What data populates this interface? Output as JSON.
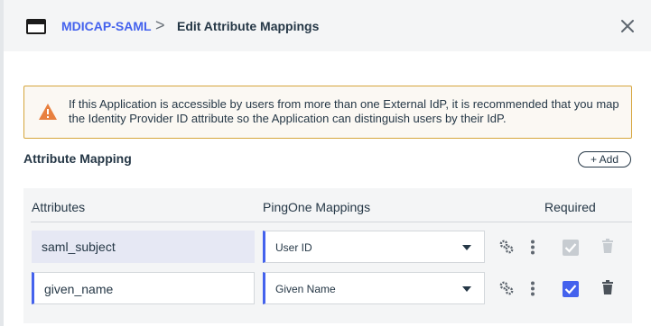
{
  "header": {
    "app_name": "MDICAP-SAML",
    "separator": ">",
    "title": "Edit Attribute Mappings"
  },
  "alert": {
    "text": "If this Application is accessible by users from more than one External IdP, it is recommended that you map the Identity Provider ID attribute so the Application can distinguish users by their IdP."
  },
  "section": {
    "title": "Attribute Mapping",
    "add_label": "+ Add"
  },
  "table": {
    "headers": {
      "attributes": "Attributes",
      "mappings": "PingOne Mappings",
      "required": "Required"
    },
    "rows": [
      {
        "attribute": "saml_subject",
        "mapping": "User ID",
        "required": true,
        "required_disabled": true
      },
      {
        "attribute": "given_name",
        "mapping": "Given Name",
        "required": true,
        "required_disabled": false
      }
    ]
  },
  "colors": {
    "accent": "#4462ed",
    "warning": "#e8803f",
    "header_bg": "#f4f5f6"
  }
}
